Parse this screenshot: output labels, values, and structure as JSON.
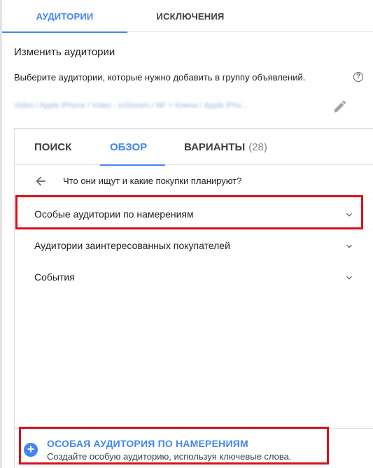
{
  "top_tabs": [
    {
      "label": "АУДИТОРИИ",
      "active": true
    },
    {
      "label": "ИСКЛЮЧЕНИЯ",
      "active": false
    }
  ],
  "section_title": "Изменить аудитории",
  "description": "Выберите аудитории, которые нужно добавить в группу объявлений.",
  "help_icon": "?",
  "breadcrumb_blurred": "Video / Apple iPhone / Video - InStream / NF > Ключи / Apple iPho...",
  "inner_tabs": {
    "search": "ПОИСК",
    "browse": "ОБЗОР",
    "variants": "ВАРИАНТЫ",
    "variants_count": "(28)"
  },
  "back_title": "Что они ищут и какие покупки планируют?",
  "list_items": [
    {
      "label": "Особые аудитории по намерениям"
    },
    {
      "label": "Аудитории заинтересованных покупателей"
    },
    {
      "label": "События"
    }
  ],
  "create": {
    "icon": "+",
    "title": "ОСОБАЯ АУДИТОРИЯ ПО НАМЕРЕНИЯМ",
    "subtitle": "Создайте особую аудиторию, используя ключевые слова."
  },
  "colors": {
    "accent": "#4285f4",
    "highlight": "#d9101a"
  }
}
